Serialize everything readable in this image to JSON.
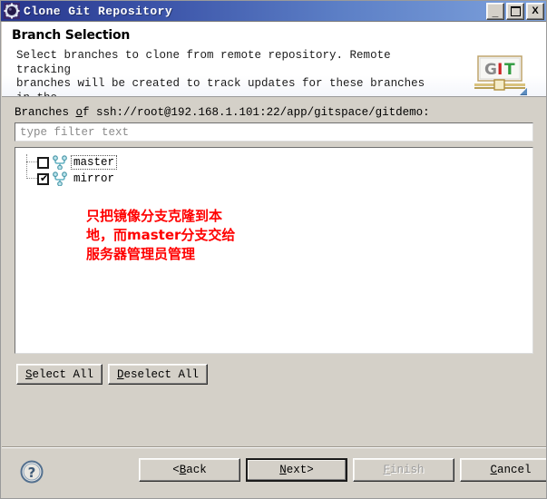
{
  "window": {
    "title": "Clone Git Repository",
    "icon": "app-gear-icon",
    "controls": {
      "minimize": "_",
      "maximize": "□",
      "close": "X"
    }
  },
  "header": {
    "title": "Branch Selection",
    "description": "Select branches to clone from remote repository. Remote tracking\nbranches will be created to track updates for these branches in the\nremote repository.",
    "logo": {
      "g": "G",
      "i": "I",
      "t": "T"
    }
  },
  "branches_section": {
    "label_prefix": "Branches ",
    "label_mnemonic": "o",
    "label_suffix": "f ssh://root@192.168.1.101:22/app/gitspace/gitdemo:",
    "filter": {
      "value": "",
      "placeholder": "type filter text"
    },
    "tree": [
      {
        "label": "master",
        "checked": false,
        "focused": true,
        "icon": "git-branch-icon"
      },
      {
        "label": "mirror",
        "checked": true,
        "focused": false,
        "icon": "git-branch-icon"
      }
    ],
    "checkmark": "✔",
    "annotation": "只把镜像分支克隆到本地，而master分支交给服务器管理员管理",
    "annotation_color": "#ff0000",
    "select_all": {
      "mnemonic": "S",
      "rest": "elect All"
    },
    "deselect_all": {
      "mnemonic": "D",
      "rest": "eselect All"
    }
  },
  "footer": {
    "help_glyph": "?",
    "buttons": {
      "back": {
        "pre": "< ",
        "mnemonic": "B",
        "rest": "ack",
        "post": "",
        "disabled": false,
        "default": false
      },
      "next": {
        "pre": "",
        "mnemonic": "N",
        "rest": "ext",
        "post": " >",
        "disabled": false,
        "default": true
      },
      "finish": {
        "pre": "",
        "mnemonic": "F",
        "rest": "inish",
        "post": "",
        "disabled": true,
        "default": false
      },
      "cancel": {
        "pre": "",
        "mnemonic": "C",
        "rest": "ancel",
        "post": "",
        "disabled": false,
        "default": false
      }
    }
  },
  "colors": {
    "titlebar_start": "#27368c",
    "titlebar_end": "#7fa3dd",
    "dialog_bg": "#d4d0c8",
    "annotation": "#ff0000",
    "logo_i": "#cc2222",
    "logo_t": "#2f9b3f",
    "logo_g": "#8a8a8a"
  }
}
